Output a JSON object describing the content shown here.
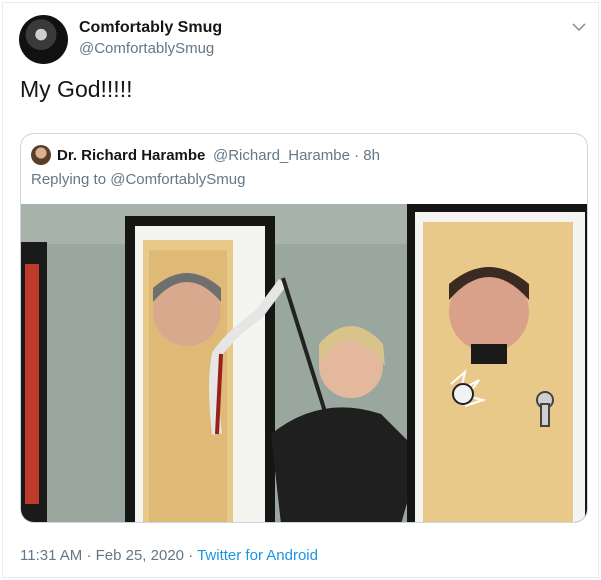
{
  "tweet": {
    "display_name": "Comfortably Smug",
    "handle": "@ComfortablySmug",
    "text": "My God!!!!!",
    "time": "11:31 AM",
    "separator": "·",
    "date": "Feb 25, 2020",
    "source": "Twitter for Android"
  },
  "quoted": {
    "display_name": "Dr. Richard Harambe",
    "handle": "@Richard_Harambe",
    "separator": "·",
    "age": "8h",
    "replying_prefix": "Replying to",
    "replying_to": "@ComfortablySmug"
  },
  "icons": {
    "menu": "chevron-down-icon"
  },
  "colors": {
    "link": "#1b95e0",
    "secondary_text": "#657786",
    "primary_text": "#14171a"
  }
}
